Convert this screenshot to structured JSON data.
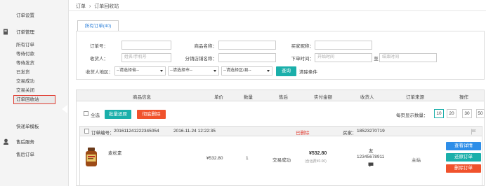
{
  "sidebar": {
    "group1": {
      "items": [
        "订单设置"
      ]
    },
    "group2": {
      "title": "订单管理",
      "items": [
        "所有订单",
        "等待付款",
        "等待发货",
        "已发货",
        "交易成功",
        "交易关闭",
        "订单回收站"
      ]
    },
    "group3": {
      "items": [
        "快递单模板"
      ]
    },
    "group4": {
      "title": "售后服务",
      "items": [
        "售后订单"
      ]
    },
    "icon_colors": {
      "order_manage": "#555555",
      "after_sale": "#555555"
    },
    "active_color": "#e03c31"
  },
  "breadcrumb": {
    "root": "订单",
    "sep": "›",
    "current": "订单回收站"
  },
  "tab": {
    "label": "所有订单(40)"
  },
  "filters": {
    "order_no_label": "订单号：",
    "product_name_label": "商品名称：",
    "buyer_name_label": "买家昵称：",
    "receiver_label": "收货人：",
    "receiver_placeholder": "姓名/手机号",
    "shop_name_label": "分销店铺名称：",
    "order_time_label": "下单时间：",
    "start_time_placeholder": "开始时间",
    "to_label": "至",
    "end_time_placeholder": "结束时间",
    "region_label": "收货人地区：",
    "province": "--请选择省--",
    "city": "--请选择市--",
    "district": "--请选择区/县--",
    "search_button": "查询",
    "clear_link": "清除条件"
  },
  "table": {
    "columns": [
      "商品信息",
      "单价",
      "数量",
      "售后",
      "实付金额",
      "收货人",
      "订单来源",
      "操作"
    ],
    "select_all": "全选",
    "batch_restore": "批量还原",
    "permanent_delete": "彻底删除",
    "page_size_label": "每页显示数量：",
    "page_sizes": [
      "10",
      "20",
      "30",
      "50"
    ],
    "selected_page_size": "10"
  },
  "order": {
    "order_no_label": "订单编号：",
    "order_no": "2016112412223450​54",
    "time": "2016-11-24 12:22:35",
    "status": "已删除",
    "buyer_label": "买家：",
    "buyer": "18523270719",
    "product_name": "麦松素",
    "unit_price": "¥532.80",
    "quantity": "1",
    "after_sale": "交易成功",
    "paid_amount": "¥532.80",
    "shipping_fee": "(含运费¥0.00)",
    "receiver_name": "友",
    "receiver_phone": "12345678911",
    "source": "主站",
    "btn_view": "查看详情",
    "btn_restore": "还原订单",
    "btn_delete": "删除订单"
  },
  "colors": {
    "teal": "#1aafaa",
    "red": "#f0522c",
    "blue": "#2e8ee8",
    "status_red": "#e03c31",
    "link_blue": "#2b7fd8"
  }
}
